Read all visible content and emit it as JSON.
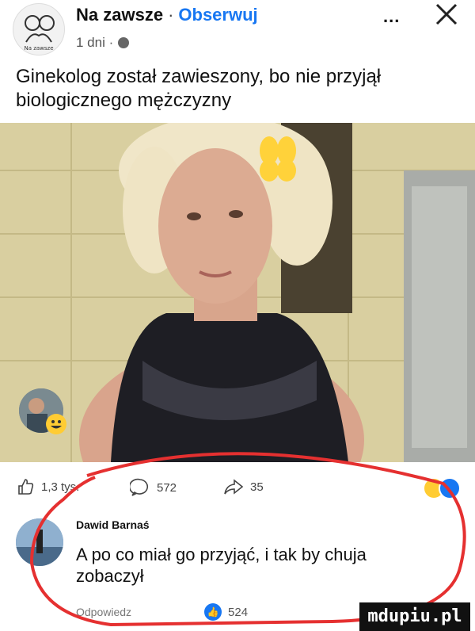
{
  "header": {
    "page_name": "Na zawsze",
    "separator": "·",
    "follow_label": "Obserwuj",
    "time": "1 dni ·",
    "more_label": "...",
    "avatar_caption": "Na zawsze"
  },
  "post": {
    "text": "Ginekolog został zawieszony, bo nie przyjął biologicznego mężczyzny"
  },
  "reactions": {
    "likes": "1,3 tys.",
    "comments": "572",
    "shares": "35"
  },
  "comment": {
    "author": "Dawid Barnaś",
    "text": "A po co miał go przyjąć, i tak by chuja zobaczył",
    "reply_label": "Odpowiedz",
    "like_count": "524"
  },
  "watermark": "mdupiu.pl",
  "colors": {
    "accent": "#1877f2",
    "annotation": "#e53030"
  }
}
